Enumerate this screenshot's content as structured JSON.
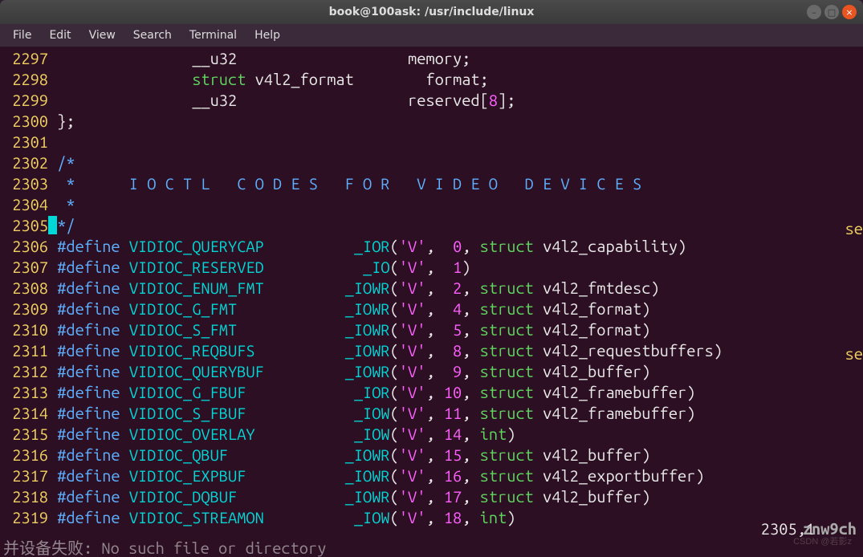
{
  "window": {
    "title": "book@100ask: /usr/include/linux"
  },
  "menu": {
    "file": "File",
    "edit": "Edit",
    "view": "View",
    "search": "Search",
    "terminal": "Terminal",
    "help": "Help"
  },
  "lines": {
    "r0": {
      "num": "2297",
      "p1": "                __u32",
      "p2": "                   memory;"
    },
    "r1": {
      "num": "2298",
      "p1": "                ",
      "kw": "struct",
      "p2": " v4l2_format        format;"
    },
    "r2": {
      "num": "2299",
      "p1": "                __u32                   reserved[",
      "n": "8",
      "p2": "];"
    },
    "r3": {
      "num": "2300",
      "p1": " };"
    },
    "r4": {
      "num": "2301"
    },
    "r5": {
      "num": "2302",
      "cm": " /*"
    },
    "r6": {
      "num": "2303",
      "cm": "  *      I O C T L   C O D E S   F O R   V I D E O   D E V I C E S"
    },
    "r7": {
      "num": "2304",
      "cm": "  *"
    },
    "r8": {
      "num": "2305",
      "cur": " ",
      "cm": "*/"
    },
    "r9": {
      "num": "2306",
      "pp": " #define ",
      "id": "VIDIOC_QUERYCAP         ",
      "pad": " ",
      "mac": "_IOR",
      "a1": "(",
      "ch": "'V'",
      "a2": ",  ",
      "n": "0",
      "a3": ", ",
      "kw": "struct",
      "ty": " v4l2_capability)"
    },
    "r10": {
      "num": "2307",
      "pp": " #define ",
      "id": "VIDIOC_RESERVED         ",
      "pad": "  ",
      "mac": "_IO",
      "a1": "(",
      "ch": "'V'",
      "a2": ",  ",
      "n": "1",
      "a3": ")"
    },
    "r11": {
      "num": "2308",
      "pp": " #define ",
      "id": "VIDIOC_ENUM_FMT         ",
      "pad": "",
      "mac": "_IOWR",
      "a1": "(",
      "ch": "'V'",
      "a2": ",  ",
      "n": "2",
      "a3": ", ",
      "kw": "struct",
      "ty": " v4l2_fmtdesc)"
    },
    "r12": {
      "num": "2309",
      "pp": " #define ",
      "id": "VIDIOC_G_FMT            ",
      "pad": "",
      "mac": "_IOWR",
      "a1": "(",
      "ch": "'V'",
      "a2": ",  ",
      "n": "4",
      "a3": ", ",
      "kw": "struct",
      "ty": " v4l2_format)"
    },
    "r13": {
      "num": "2310",
      "pp": " #define ",
      "id": "VIDIOC_S_FMT            ",
      "pad": "",
      "mac": "_IOWR",
      "a1": "(",
      "ch": "'V'",
      "a2": ",  ",
      "n": "5",
      "a3": ", ",
      "kw": "struct",
      "ty": " v4l2_format)"
    },
    "r14": {
      "num": "2311",
      "pp": " #define ",
      "id": "VIDIOC_REQBUFS          ",
      "pad": "",
      "mac": "_IOWR",
      "a1": "(",
      "ch": "'V'",
      "a2": ",  ",
      "n": "8",
      "a3": ", ",
      "kw": "struct",
      "ty": " v4l2_requestbuffers)"
    },
    "r15": {
      "num": "2312",
      "pp": " #define ",
      "id": "VIDIOC_QUERYBUF         ",
      "pad": "",
      "mac": "_IOWR",
      "a1": "(",
      "ch": "'V'",
      "a2": ",  ",
      "n": "9",
      "a3": ", ",
      "kw": "struct",
      "ty": " v4l2_buffer)"
    },
    "r16": {
      "num": "2313",
      "pp": " #define ",
      "id": "VIDIOC_G_FBUF           ",
      "pad": " ",
      "mac": "_IOR",
      "a1": "(",
      "ch": "'V'",
      "a2": ", ",
      "n": "10",
      "a3": ", ",
      "kw": "struct",
      "ty": " v4l2_framebuffer)"
    },
    "r17": {
      "num": "2314",
      "pp": " #define ",
      "id": "VIDIOC_S_FBUF           ",
      "pad": " ",
      "mac": "_IOW",
      "a1": "(",
      "ch": "'V'",
      "a2": ", ",
      "n": "11",
      "a3": ", ",
      "kw": "struct",
      "ty": " v4l2_framebuffer)"
    },
    "r18": {
      "num": "2315",
      "pp": " #define ",
      "id": "VIDIOC_OVERLAY          ",
      "pad": " ",
      "mac": "_IOW",
      "a1": "(",
      "ch": "'V'",
      "a2": ", ",
      "n": "14",
      "a3": ", ",
      "kw2": "int",
      "a4": ")"
    },
    "r19": {
      "num": "2316",
      "pp": " #define ",
      "id": "VIDIOC_QBUF             ",
      "pad": "",
      "mac": "_IOWR",
      "a1": "(",
      "ch": "'V'",
      "a2": ", ",
      "n": "15",
      "a3": ", ",
      "kw": "struct",
      "ty": " v4l2_buffer)"
    },
    "r20": {
      "num": "2317",
      "pp": " #define ",
      "id": "VIDIOC_EXPBUF           ",
      "pad": "",
      "mac": "_IOWR",
      "a1": "(",
      "ch": "'V'",
      "a2": ", ",
      "n": "16",
      "a3": ", ",
      "kw": "struct",
      "ty": " v4l2_exportbuffer)"
    },
    "r21": {
      "num": "2318",
      "pp": " #define ",
      "id": "VIDIOC_DQBUF            ",
      "pad": "",
      "mac": "_IOWR",
      "a1": "(",
      "ch": "'V'",
      "a2": ", ",
      "n": "17",
      "a3": ", ",
      "kw": "struct",
      "ty": " v4l2_buffer)"
    },
    "r22": {
      "num": "2319",
      "pp": " #define ",
      "id": "VIDIOC_STREAMON         ",
      "pad": " ",
      "mac": "_IOW",
      "a1": "(",
      "ch": "'V'",
      "a2": ", ",
      "n": "18",
      "a3": ", ",
      "kw2": "int",
      "a4": ")"
    }
  },
  "side": {
    "s1": "se",
    "s2": "se"
  },
  "status": {
    "pos": "2305,1"
  },
  "watermark": "znw9ch",
  "bottom_msg": "并设备失败: No such file or directory",
  "csdn": "CSDN @若影z"
}
